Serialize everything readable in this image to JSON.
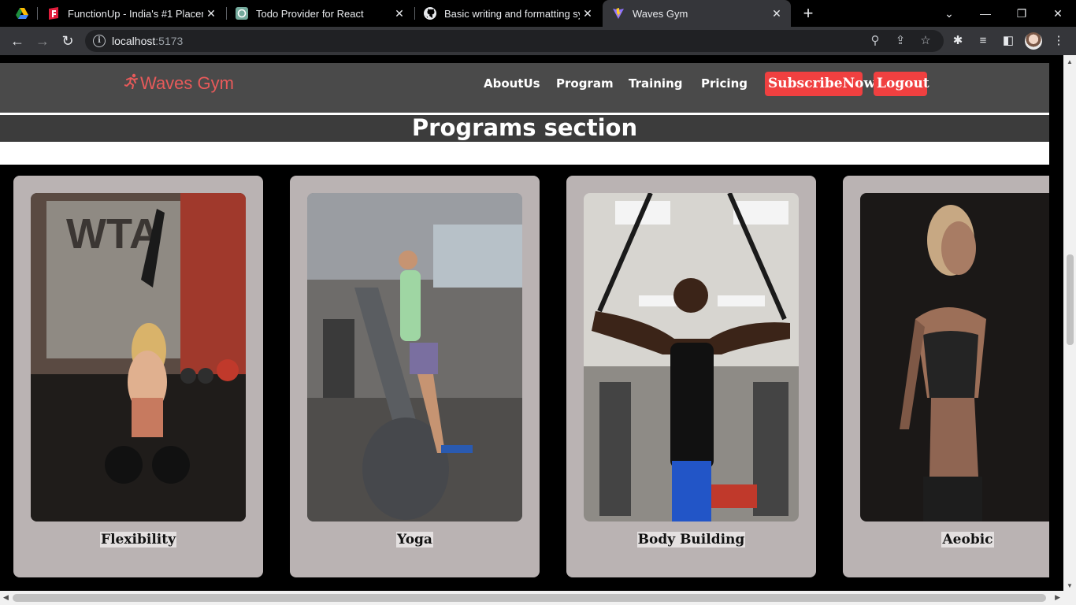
{
  "browser": {
    "tabs": [
      {
        "title": "FunctionUp - India's #1 Placemen",
        "icon": "functionup-favicon"
      },
      {
        "title": "Todo Provider for React",
        "icon": "chatgpt-favicon"
      },
      {
        "title": "Basic writing and formatting synt",
        "icon": "github-favicon"
      },
      {
        "title": "Waves Gym",
        "icon": "vite-favicon"
      }
    ],
    "url_host": "localhost",
    "url_port": ":5173"
  },
  "site": {
    "logo_text": "Waves Gym",
    "nav": {
      "about": "AboutUs",
      "program": "Program",
      "training": "Training",
      "pricing": "Pricing"
    },
    "subscribe_label": "SubscribeNow",
    "logout_label": "Logout",
    "section_title": "Programs section",
    "programs": [
      {
        "label": "Flexibility"
      },
      {
        "label": "Yoga"
      },
      {
        "label": "Body Building"
      },
      {
        "label": "Aeobic"
      }
    ],
    "colors": {
      "brand_red": "#f04040",
      "navbar": "#4a4a4a",
      "card": "#bab3b3"
    }
  }
}
